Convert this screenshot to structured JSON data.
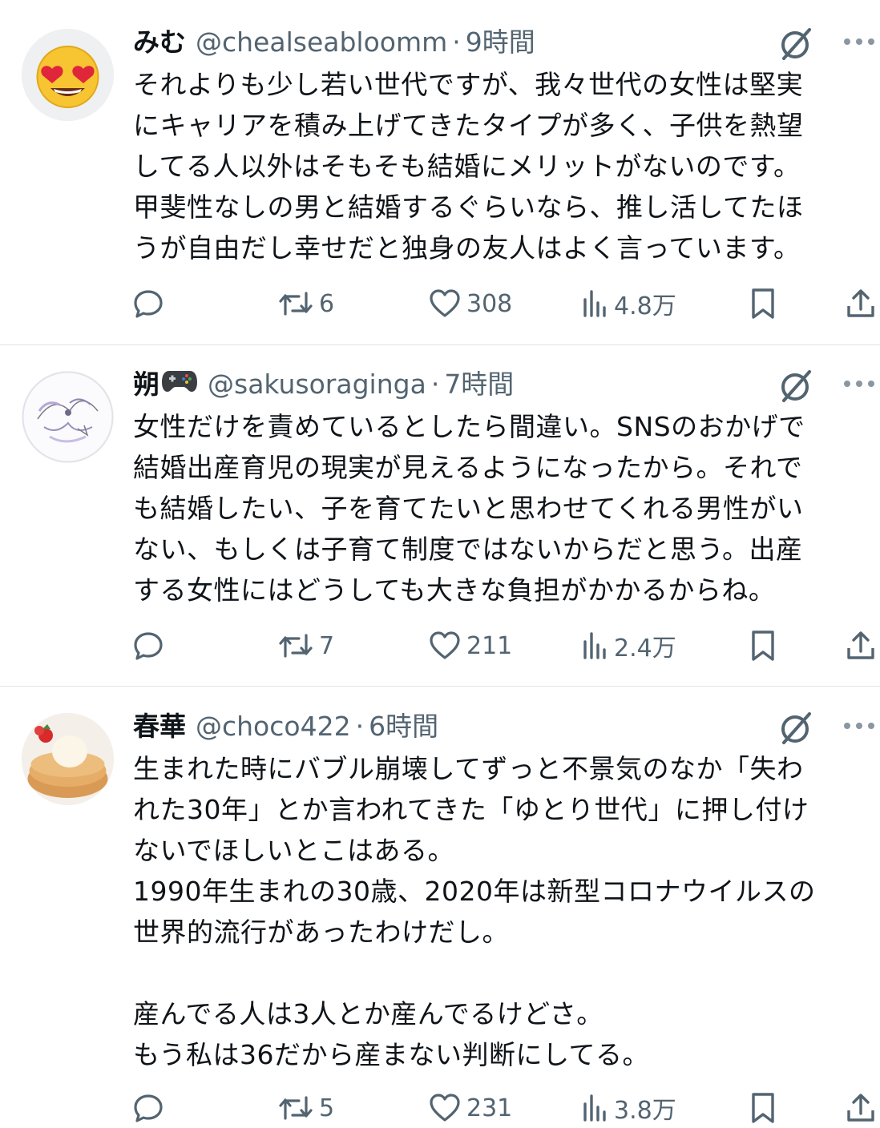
{
  "tweets": [
    {
      "name": "みむ",
      "handle": "@chealseabloomm",
      "separator": "·",
      "time": "9時間",
      "avatar": "heart-eyes-emoji",
      "name_emoji": "",
      "body": "それよりも少し若い世代ですが、我々世代の女性は堅実\nにキャリアを積み上げてきたタイプが多く、子供を熱望\nしてる人以外はそもそも結婚にメリットがないのです。\n甲斐性なしの男と結婚するぐらいなら、推し活してたほ\nうが自由だし幸せだと独身の友人はよく言っています。",
      "retweets": "6",
      "likes": "308",
      "views": "4.8万"
    },
    {
      "name": "朔",
      "handle": "@sakusoraginga",
      "separator": "·",
      "time": "7時間",
      "avatar": "sketch-illustration",
      "name_emoji": "game-controller",
      "body": "女性だけを責めているとしたら間違い。SNSのおかげで\n結婚出産育児の現実が見えるようになったから。それで\nも結婚したい、子を育てたいと思わせてくれる男性がい\nない、もしくは子育て制度ではないからだと思う。出産\nする女性にはどうしても大きな負担がかかるからね。",
      "retweets": "7",
      "likes": "211",
      "views": "2.4万"
    },
    {
      "name": "春華",
      "handle": "@choco422",
      "separator": "·",
      "time": "6時間",
      "avatar": "pancake-photo",
      "name_emoji": "",
      "body": "生まれた時にバブル崩壊してずっと不景気のなか「失わ\nれた30年」とか言われてきた「ゆとり世代」に押し付け\nないでほしいとこはある。\n1990年生まれの30歳、2020年は新型コロナウイルスの\n世界的流行があったわけだし。\n\n産んでる人は3人とか産んでるけどさ。\nもう私は36だから産まない判断にしてる。",
      "retweets": "5",
      "likes": "231",
      "views": "3.8万"
    }
  ],
  "colors": {
    "text": "#0f1419",
    "secondary": "#536471",
    "divider": "#dfe3e7"
  }
}
